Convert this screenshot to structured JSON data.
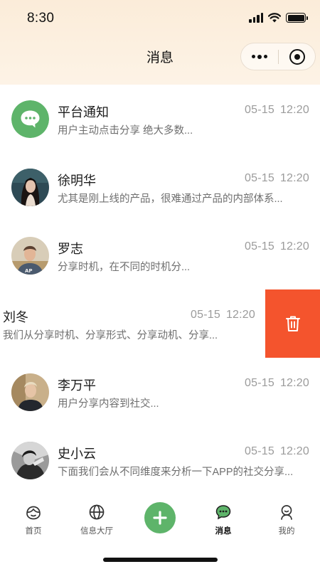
{
  "status_bar": {
    "time": "8:30"
  },
  "nav": {
    "title": "消息"
  },
  "messages": [
    {
      "name": "平台通知",
      "date": "05-15",
      "time": "12:20",
      "preview": "用户主动点击分享 绝大多数...",
      "avatar": "notification-icon"
    },
    {
      "name": "徐明华",
      "date": "05-15",
      "time": "12:20",
      "preview": "尤其是刚上线的产品，很难通过产品的内部体系...",
      "avatar": "user-photo"
    },
    {
      "name": "罗志",
      "date": "05-15",
      "time": "12:20",
      "preview": "分享时机，在不同的时机分...",
      "avatar": "user-photo"
    },
    {
      "name": "刘冬",
      "date": "05-15",
      "time": "12:20",
      "preview": "我们从分享时机、分享形式、分享动机、分享...",
      "avatar": "user-photo",
      "swiped": true
    },
    {
      "name": "李万平",
      "date": "05-15",
      "time": "12:20",
      "preview": "用户分享内容到社交...",
      "avatar": "user-photo"
    },
    {
      "name": "史小云",
      "date": "05-15",
      "time": "12:20",
      "preview": "下面我们会从不同维度来分析一下APP的社交分享...",
      "avatar": "user-photo"
    }
  ],
  "delete_action": {
    "icon": "trash-icon",
    "color": "#f4542d"
  },
  "tabbar": {
    "items": [
      {
        "label": "首页",
        "icon": "home-face-icon"
      },
      {
        "label": "信息大厅",
        "icon": "globe-icon"
      },
      {
        "label": "消息",
        "icon": "chat-bubble-icon",
        "active": true
      },
      {
        "label": "我的",
        "icon": "profile-icon"
      }
    ],
    "center_button": {
      "icon": "plus-icon",
      "color": "#5eb46a"
    }
  },
  "colors": {
    "accent_green": "#5eb46a",
    "header_bg": "#fbecd9",
    "delete_red": "#f4542d"
  }
}
